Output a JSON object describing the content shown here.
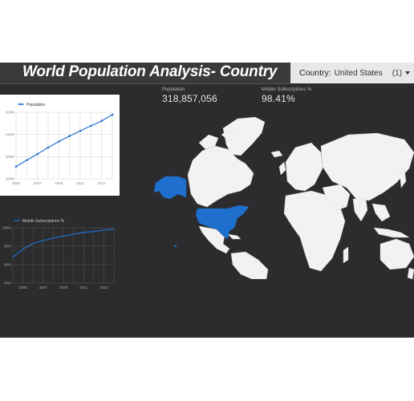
{
  "header": {
    "title": "World Population Analysis- Country"
  },
  "filter": {
    "label": "Country:",
    "value": "United States",
    "count": "(1)"
  },
  "metrics": [
    {
      "label": "Population",
      "value": "318,857,056"
    },
    {
      "label": "Mobile Subscriptions %",
      "value": "98.41%"
    }
  ],
  "colors": {
    "accent": "#1f6fce",
    "background": "#2c2c2e",
    "land": "#f2f2f2"
  },
  "map": {
    "highlighted_country": "United States"
  },
  "chart_data": [
    {
      "type": "line",
      "series": [
        {
          "name": "Population",
          "values": [
            295.5,
            298.4,
            301.2,
            304.1,
            306.8,
            309.3,
            311.6,
            313.9,
            316.1,
            318.9
          ]
        }
      ],
      "x": [
        2005,
        2006,
        2007,
        2008,
        2009,
        2010,
        2011,
        2012,
        2013,
        2014
      ],
      "xticks": [
        "2005",
        "2007",
        "2009",
        "2011",
        "2013"
      ],
      "yticks": [
        "290M",
        "300M",
        "310M",
        "320M"
      ],
      "ylim": [
        290,
        320
      ],
      "grid": true,
      "legend": "top-left"
    },
    {
      "type": "line",
      "series": [
        {
          "name": "Mobile Subscriptions %",
          "values": [
            68,
            77,
            83,
            86,
            89,
            91,
            93,
            95,
            96,
            97.5,
            98.4
          ]
        }
      ],
      "x": [
        2004,
        2005,
        2006,
        2007,
        2008,
        2009,
        2010,
        2011,
        2012,
        2013,
        2014
      ],
      "xticks": [
        "2005",
        "2007",
        "2009",
        "2011",
        "2013"
      ],
      "yticks": [
        "40%",
        "60%",
        "80%",
        "100%"
      ],
      "ylim": [
        40,
        100
      ],
      "grid": true,
      "legend": "top-left"
    }
  ]
}
